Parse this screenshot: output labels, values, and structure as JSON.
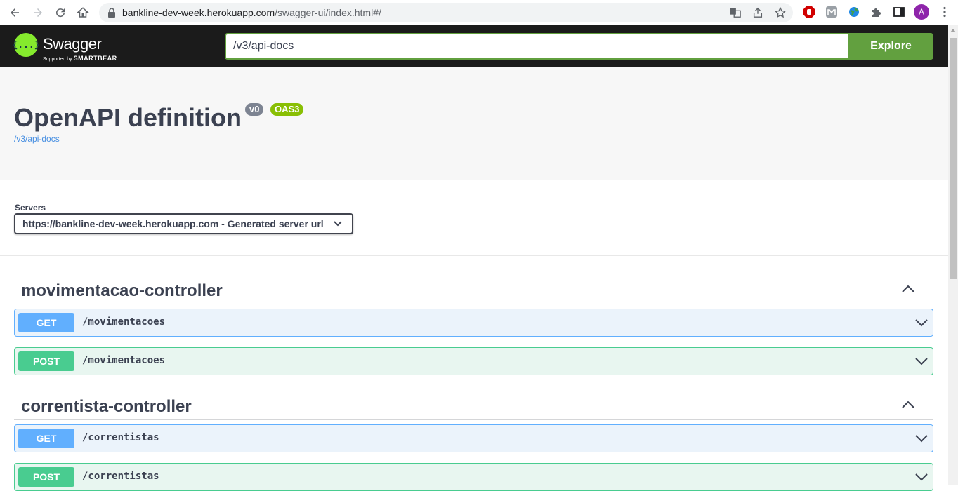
{
  "browser": {
    "url_host": "bankline-dev-week.herokuapp.com",
    "url_path": "/swagger-ui/index.html#/",
    "avatar_letter": "A"
  },
  "topbar": {
    "logo_title": "Swagger",
    "logo_supported_by": "Supported by",
    "logo_brand": "SMARTBEAR",
    "logo_glyph": "{...}",
    "spec_url": "/v3/api-docs",
    "explore_label": "Explore"
  },
  "info": {
    "title": "OpenAPI definition",
    "version_badge": "v0",
    "oas_badge": "OAS3",
    "spec_link": "/v3/api-docs"
  },
  "servers": {
    "label": "Servers",
    "selected": "https://bankline-dev-week.herokuapp.com - Generated server url"
  },
  "tags": [
    {
      "name": "movimentacao-controller",
      "operations": [
        {
          "method": "GET",
          "path": "/movimentacoes"
        },
        {
          "method": "POST",
          "path": "/movimentacoes"
        }
      ]
    },
    {
      "name": "correntista-controller",
      "operations": [
        {
          "method": "GET",
          "path": "/correntistas"
        },
        {
          "method": "POST",
          "path": "/correntistas"
        }
      ]
    }
  ],
  "colors": {
    "get": "#61affe",
    "post": "#49cc90",
    "accent": "#62a03f",
    "logo": "#85ea2d"
  }
}
